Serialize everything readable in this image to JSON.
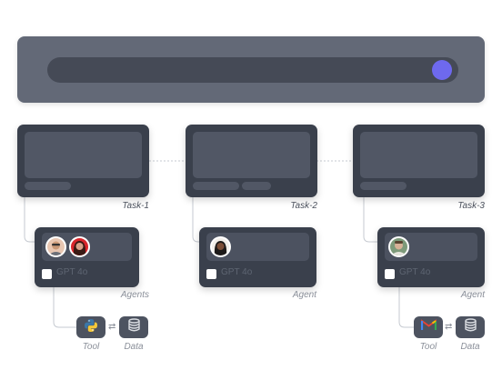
{
  "colors": {
    "accent": "#6e69ee"
  },
  "tasks": [
    {
      "caption": "Task-1"
    },
    {
      "caption": "Task-2"
    },
    {
      "caption": "Task-3"
    }
  ],
  "agents": [
    {
      "model": "GPT 4o",
      "caption": "Agents",
      "avatars": [
        "avatar-man-glasses",
        "avatar-woman-red"
      ]
    },
    {
      "model": "GPT 4o",
      "caption": "Agent",
      "avatars": [
        "avatar-woman-dark"
      ]
    },
    {
      "model": "GPT 4o",
      "caption": "Agent",
      "avatars": [
        "avatar-man-green"
      ]
    }
  ],
  "resources": [
    {
      "tool_caption": "Tool",
      "data_caption": "Data",
      "tool_icon": "python-icon",
      "data_icon": "database-icon"
    },
    {
      "tool_caption": "Tool",
      "data_caption": "Data",
      "tool_icon": "gmail-icon",
      "data_icon": "database-icon"
    }
  ]
}
